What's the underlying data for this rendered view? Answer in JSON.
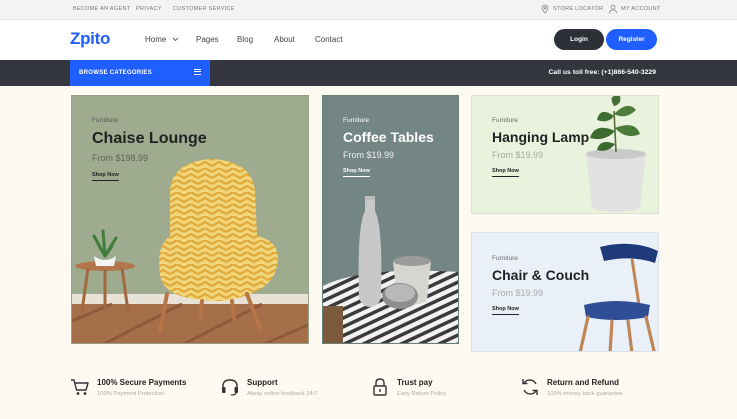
{
  "topbar": {
    "links": [
      "BECOME AN AGENT",
      "PRIVACY",
      "CUSTOMER SERVICE"
    ],
    "store_locator": "STORE LOCATOR",
    "my_account": "MY ACCOUNT"
  },
  "header": {
    "logo": "Zpito",
    "nav": [
      "Home",
      "Pages",
      "Blog",
      "About",
      "Contact"
    ],
    "login": "Login",
    "register": "Register"
  },
  "catbar": {
    "browse": "BROWSE CATEGORIES",
    "phone": "Call us toll free: (+1)866-540-3229"
  },
  "cards": [
    {
      "category": "Furniture",
      "title": "Chaise Lounge",
      "price": "From $198.99",
      "cta": "Shop Now"
    },
    {
      "category": "Furniture",
      "title": "Coffee Tables",
      "price": "From $19.99",
      "cta": "Shop Now"
    },
    {
      "category": "Furniture",
      "title": "Hanging Lamp",
      "price": "From $19.99",
      "cta": "Shop Now"
    },
    {
      "category": "Furniture",
      "title": "Chair & Couch",
      "price": "From $19.99",
      "cta": "Shop Now"
    }
  ],
  "features": [
    {
      "icon": "cart-icon",
      "title": "100% Secure Payments",
      "subtitle": "100% Payment Protection."
    },
    {
      "icon": "headset-icon",
      "title": "Support",
      "subtitle": "Alway online feedback 24/7"
    },
    {
      "icon": "lock-icon",
      "title": "Trust pay",
      "subtitle": "Easy Return Policy."
    },
    {
      "icon": "refresh-icon",
      "title": "Return and Refund",
      "subtitle": "100% money back guarantee"
    }
  ],
  "colors": {
    "brand": "#1f5fff",
    "dark": "#33373d",
    "button_dark": "#2d3137"
  }
}
